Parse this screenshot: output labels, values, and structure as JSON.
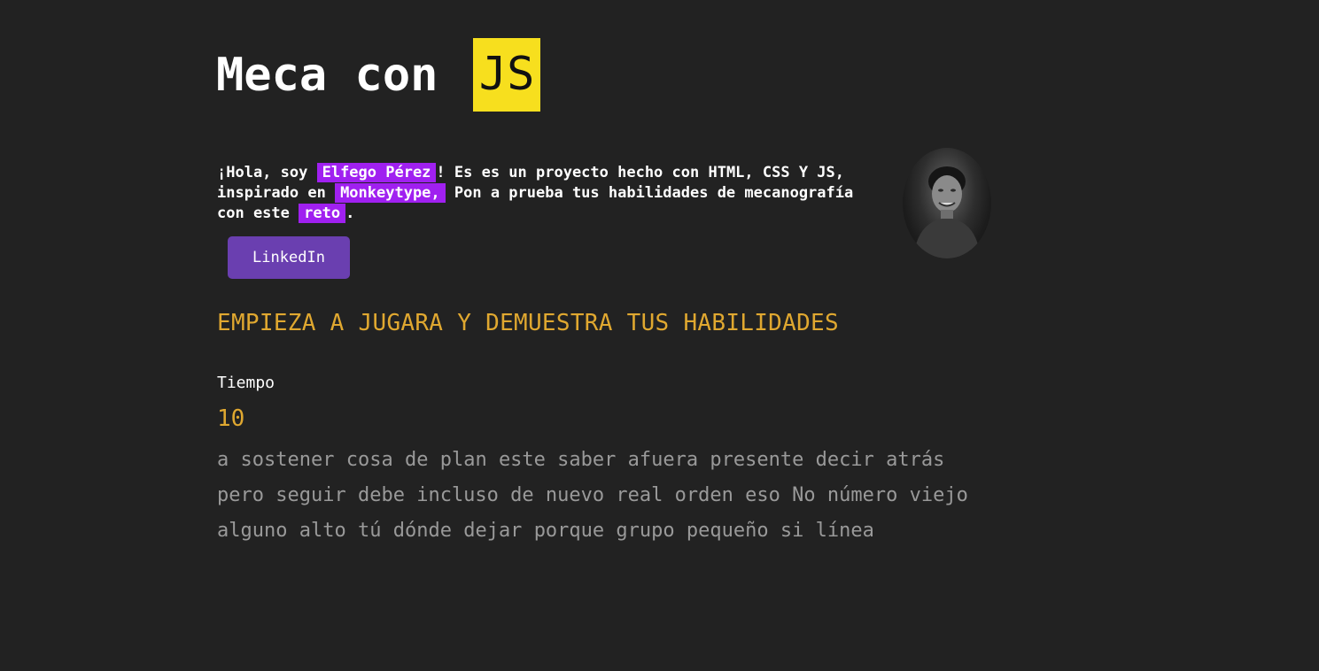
{
  "header": {
    "title_text": "Meca con ",
    "title_badge": "JS"
  },
  "intro": {
    "part1": "¡Hola, soy ",
    "name": "Elfego Pérez",
    "part2": "! Es es un proyecto hecho con HTML, CSS Y JS, inspirado en ",
    "monkeytype": "Monkeytype,",
    "part3": " Pon a prueba tus habilidades de mecanografía con este ",
    "reto": "reto",
    "part4": "."
  },
  "avatar": {
    "icon": "profile-photo"
  },
  "buttons": {
    "linkedin_label": "LinkedIn"
  },
  "game": {
    "subtitle": "EMPIEZA A JUGARA Y DEMUESTRA TUS HABILIDADES",
    "time_label": "Tiempo",
    "time_value": "10",
    "words": [
      "a",
      "sostener",
      "cosa",
      "de",
      "plan",
      "este",
      "saber",
      "afuera",
      "presente",
      "decir",
      "atrás",
      "pero",
      "seguir",
      "debe",
      "incluso",
      "de",
      "nuevo",
      "real",
      "orden",
      "eso",
      "No",
      "número",
      "viejo",
      "alguno",
      "alto",
      "tú",
      "dónde",
      "dejar",
      "porque",
      "grupo",
      "pequeño",
      "si",
      "línea"
    ]
  },
  "colors": {
    "background": "#222222",
    "js_badge": "#f7df1e",
    "highlight": "#a020f0",
    "accent": "#e0a830",
    "button": "#6a3fb0",
    "word_text": "#999999"
  }
}
